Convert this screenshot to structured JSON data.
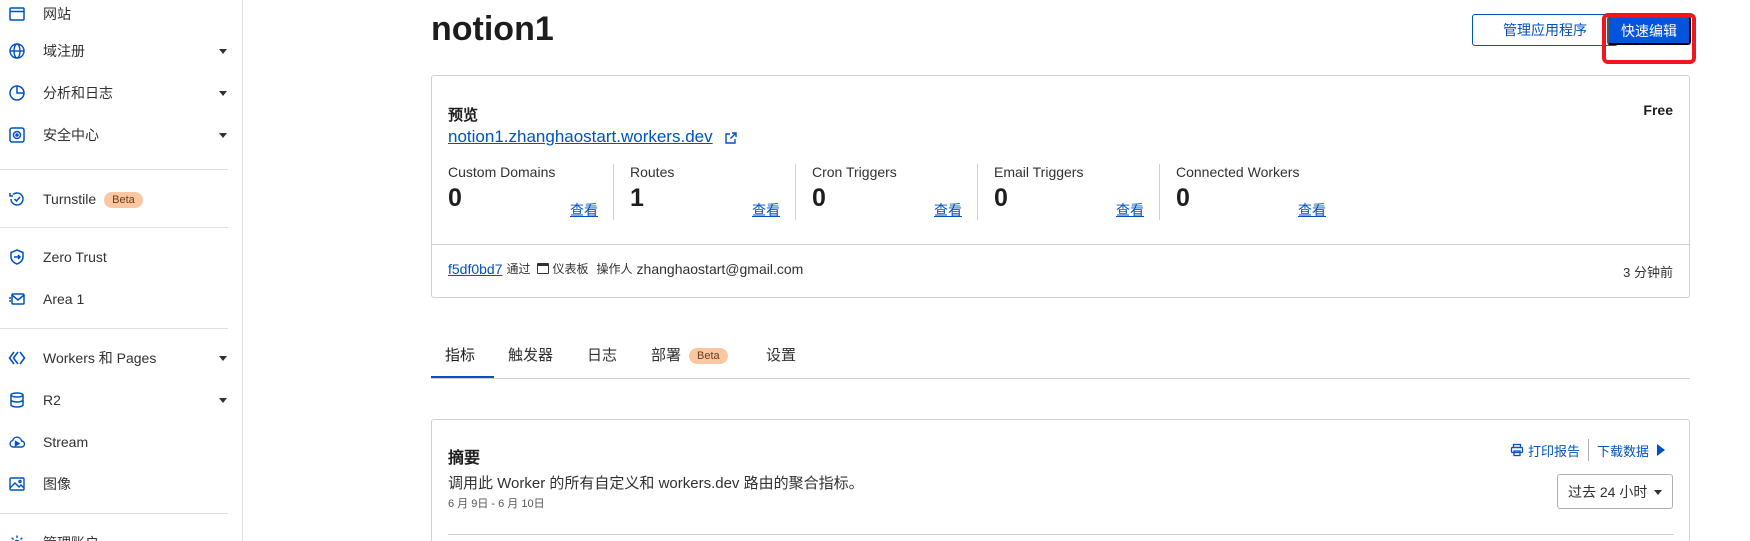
{
  "sidebar": {
    "items": [
      {
        "label": "网站",
        "icon": "browser-window-icon"
      },
      {
        "label": "域注册",
        "icon": "globe-icon"
      },
      {
        "label": "分析和日志",
        "icon": "pie-chart-icon"
      },
      {
        "label": "安全中心",
        "icon": "shield-target-icon"
      },
      {
        "label": "Turnstile",
        "icon": "turnstile-icon",
        "badge": "Beta"
      },
      {
        "label": "Zero Trust",
        "icon": "zero-trust-icon"
      },
      {
        "label": "Area 1",
        "icon": "mail-shield-icon"
      },
      {
        "label": "Workers 和 Pages",
        "icon": "workers-icon"
      },
      {
        "label": "R2",
        "icon": "database-icon"
      },
      {
        "label": "Stream",
        "icon": "cloud-play-icon"
      },
      {
        "label": "图像",
        "icon": "image-icon"
      },
      {
        "label": "管理账户",
        "icon": "gear-icon"
      }
    ]
  },
  "header": {
    "title": "notion1",
    "manage_label": "管理应用程序",
    "quick_edit_label": "快速编辑"
  },
  "overview": {
    "heading": "预览",
    "plan": "Free",
    "url": "notion1.zhanghaostart.workers.dev",
    "stats": [
      {
        "label": "Custom Domains",
        "value": "0",
        "link": "查看"
      },
      {
        "label": "Routes",
        "value": "1",
        "link": "查看"
      },
      {
        "label": "Cron Triggers",
        "value": "0",
        "link": "查看"
      },
      {
        "label": "Email Triggers",
        "value": "0",
        "link": "查看"
      },
      {
        "label": "Connected Workers",
        "value": "0",
        "link": "查看"
      }
    ],
    "deploy": {
      "hash": "f5df0bd7",
      "via": "通过",
      "source": "仪表板",
      "operator_label": "操作人",
      "operator": "zhanghaostart@gmail.com",
      "time": "3 分钟前"
    }
  },
  "tabs": [
    {
      "label": "指标"
    },
    {
      "label": "触发器"
    },
    {
      "label": "日志"
    },
    {
      "label": "部署",
      "badge": "Beta"
    },
    {
      "label": "设置"
    }
  ],
  "summary": {
    "title": "摘要",
    "description": "调用此 Worker 的所有自定义和 workers.dev 路由的聚合指标。",
    "date_range": "6 月 9日 - 6 月 10日",
    "print_label": "打印报告",
    "download_label": "下载数据",
    "range_value": "过去 24 小时"
  },
  "colors": {
    "accent": "#0051c3",
    "primary_button": "#0055dc",
    "highlight": "#f0161d",
    "beta_badge": "#f9c8a2"
  }
}
